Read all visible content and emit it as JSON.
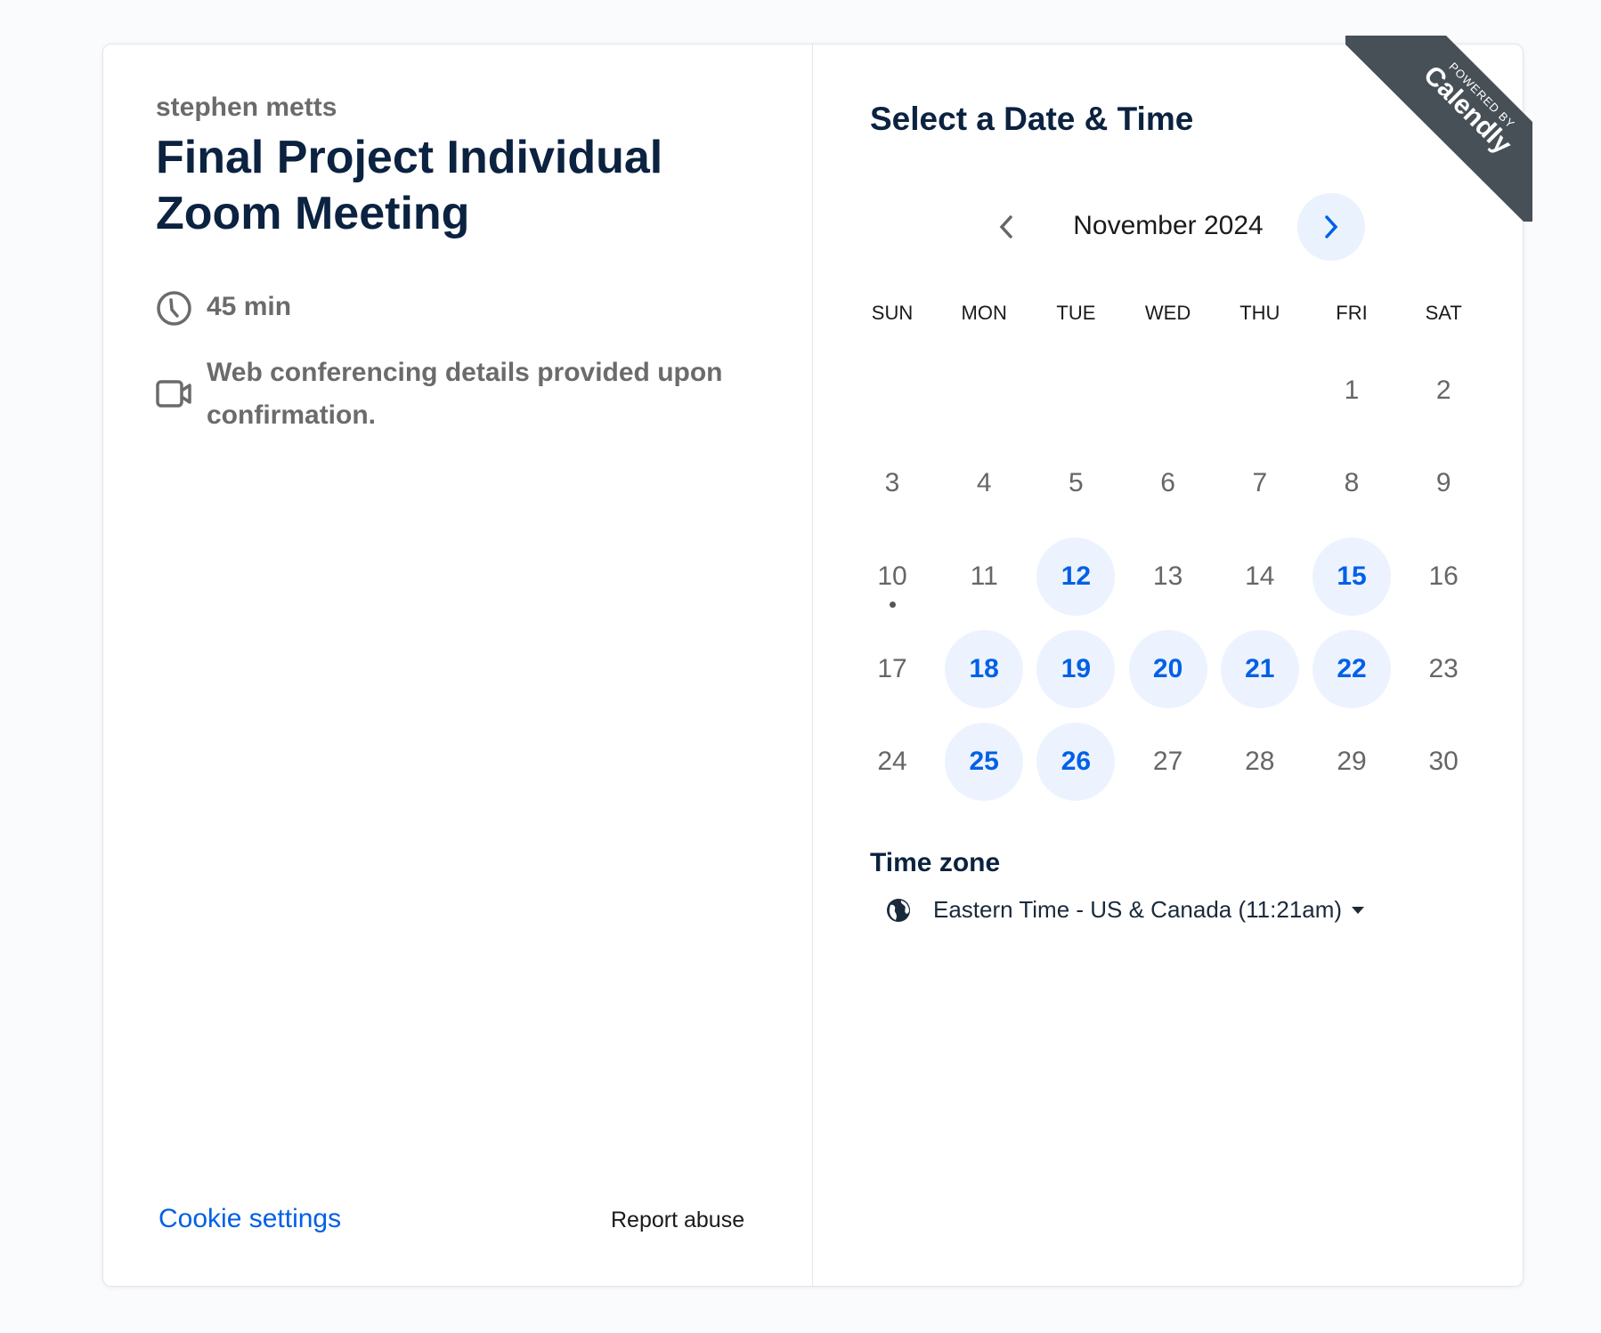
{
  "event": {
    "organizer": "stephen metts",
    "title": "Final Project Individual Zoom Meeting",
    "duration": "45 min",
    "conferencing": "Web conferencing details provided upon confirmation."
  },
  "footer": {
    "cookie_settings": "Cookie settings",
    "report_abuse": "Report abuse"
  },
  "scheduler": {
    "heading": "Select a Date & Time",
    "month_label": "November 2024",
    "weekdays": [
      "SUN",
      "MON",
      "TUE",
      "WED",
      "THU",
      "FRI",
      "SAT"
    ],
    "first_weekday_index": 5,
    "days_in_month": 30,
    "today": 10,
    "available_days": [
      12,
      15,
      18,
      19,
      20,
      21,
      22,
      25,
      26
    ],
    "timezone_label": "Time zone",
    "timezone_value": "Eastern Time - US & Canada (11:21am)"
  },
  "branding": {
    "powered_by": "POWERED BY",
    "brand": "Calendly",
    "ribbon_color": "#474f57"
  },
  "colors": {
    "accent": "#0060e6",
    "available_bg": "#edf3fe",
    "title": "#0b2240"
  }
}
